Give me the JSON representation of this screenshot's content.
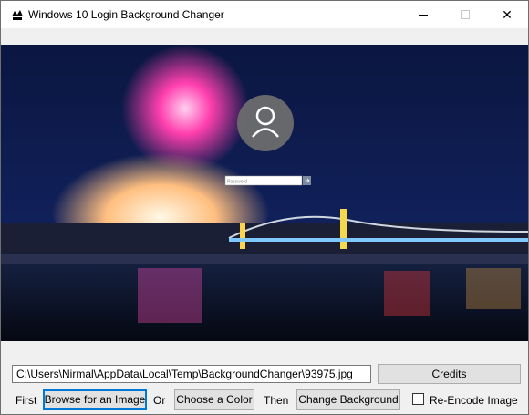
{
  "window": {
    "title": "Windows 10 Login Background Changer",
    "icon": "app-icon",
    "controls": {
      "minimize": "minimize-icon",
      "maximize": "maximize-icon",
      "close_glyph": "✕"
    }
  },
  "preview": {
    "password_placeholder": "Password",
    "avatar_icon": "user-icon"
  },
  "path": {
    "value": "C:\\Users\\Nirmal\\AppData\\Local\\Temp\\BackgroundChanger\\93975.jpg"
  },
  "actions": {
    "credits_label": "Credits",
    "first_label": "First",
    "browse_label": "Browse for an Image",
    "or_label": "Or",
    "color_label": "Choose a Color",
    "then_label": "Then",
    "change_label": "Change Background",
    "reencode_label": "Re-Encode Image",
    "reencode_checked": false
  },
  "colors": {
    "accent": "#0078d7",
    "button_bg": "#e1e1e1",
    "window_bg": "#f0f0f0"
  }
}
